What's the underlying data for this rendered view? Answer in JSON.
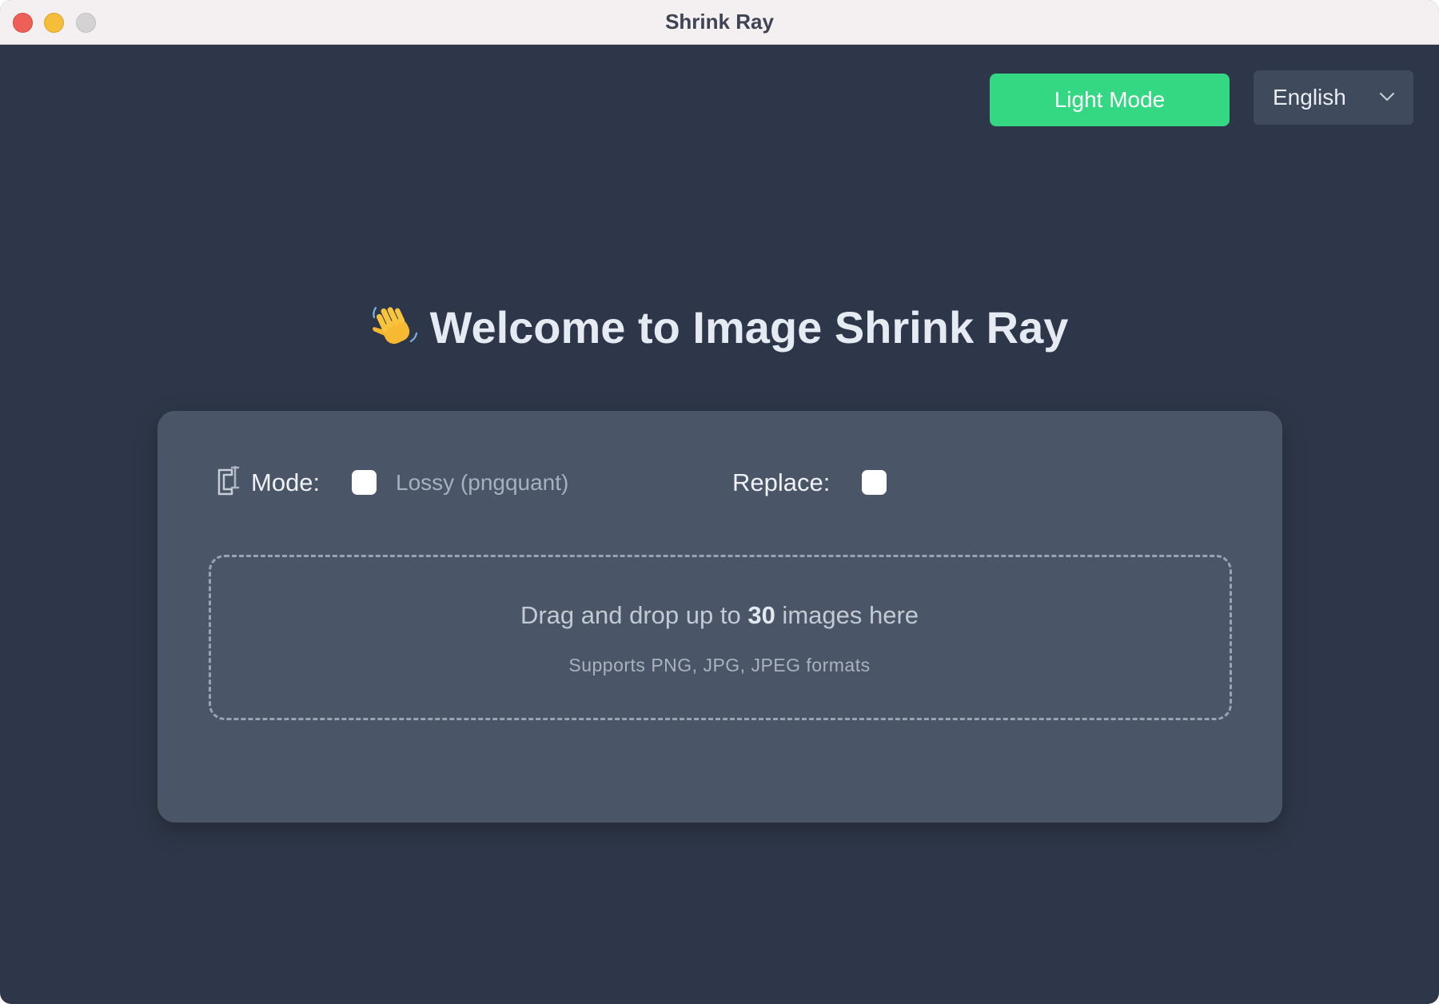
{
  "window": {
    "title": "Shrink Ray"
  },
  "header": {
    "theme_button_label": "Light Mode",
    "language_selected": "English"
  },
  "main": {
    "heading": "Welcome to Image Shrink Ray",
    "mode_label": "Mode:",
    "mode_option": "Lossy (pngquant)",
    "mode_checked": false,
    "replace_label": "Replace:",
    "replace_checked": false,
    "dropzone": {
      "text_before": "Drag and drop up to ",
      "max_count": "30",
      "text_after": " images here",
      "formats_note": "Supports PNG, JPG, JPEG formats"
    }
  },
  "icons": {
    "heading_icon": "waving-hand-icon",
    "mode_icon": "clamp-icon",
    "language_icon": "chevron-down-icon"
  },
  "colors": {
    "background": "#2e3749",
    "card": "#4a5568",
    "accent": "#34d883",
    "select_bg": "#3f4a5c"
  }
}
